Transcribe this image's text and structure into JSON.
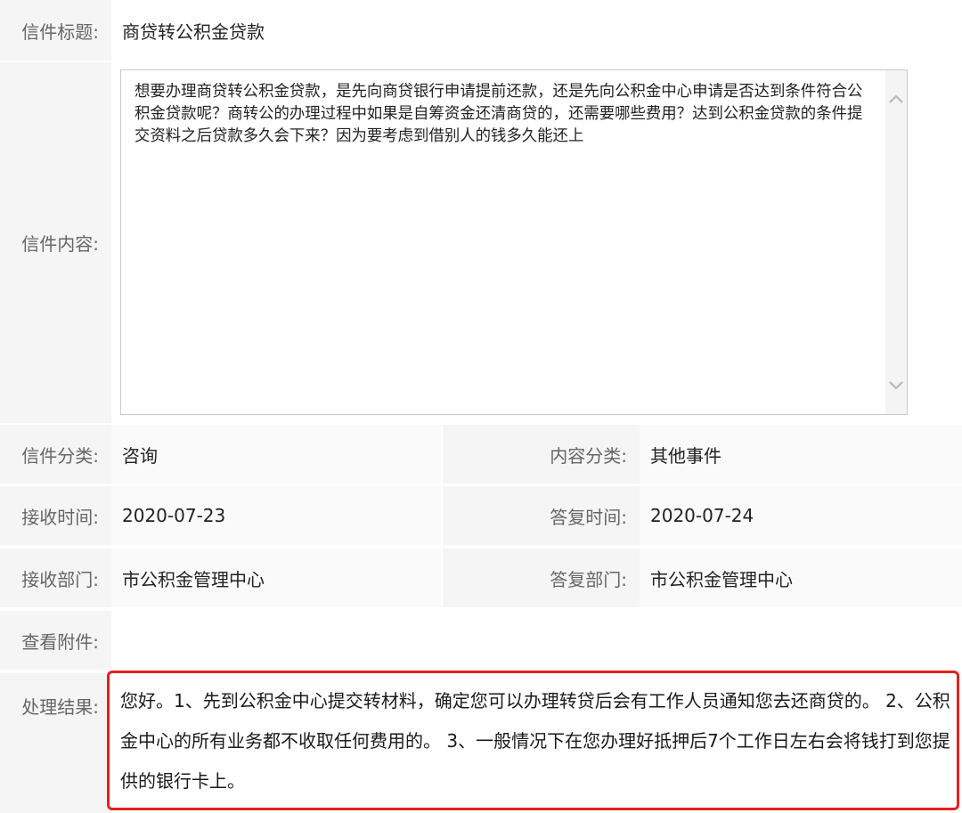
{
  "title_row": {
    "label": "信件标题:",
    "value": "商贷转公积金贷款"
  },
  "content_row": {
    "label": "信件内容:",
    "text": "想要办理商贷转公积金贷款，是先向商贷银行申请提前还款，还是先向公积金中心申请是否达到条件符合公积金贷款呢？商转公的办理过程中如果是自筹资金还清商贷的，还需要哪些费用？达到公积金贷款的条件提交资料之后贷款多久会下来？因为要考虑到借别人的钱多久能还上"
  },
  "category_row": {
    "label": "信件分类:",
    "value": "咨询",
    "label2": "内容分类:",
    "value2": "其他事件"
  },
  "time_row": {
    "label": "接收时间:",
    "value": "2020-07-23",
    "label2": "答复时间:",
    "value2": "2020-07-24"
  },
  "dept_row": {
    "label": "接收部门:",
    "value": "市公积金管理中心",
    "label2": "答复部门:",
    "value2": "市公积金管理中心"
  },
  "attachment_row": {
    "label": "查看附件:"
  },
  "result_row": {
    "label": "处理结果:",
    "text": "您好。1、先到公积金中心提交转材料，确定您可以办理转贷后会有工作人员通知您去还商贷的。 2、公积金中心的所有业务都不收取任何费用的。 3、一般情况下在您办理好抵押后7个工作日左右会将钱打到您提供的银行卡上。"
  },
  "colors": {
    "highlight_border": "#e62020"
  },
  "icons": {
    "scroll_up": "chevron-up-icon",
    "scroll_down": "chevron-down-icon"
  }
}
